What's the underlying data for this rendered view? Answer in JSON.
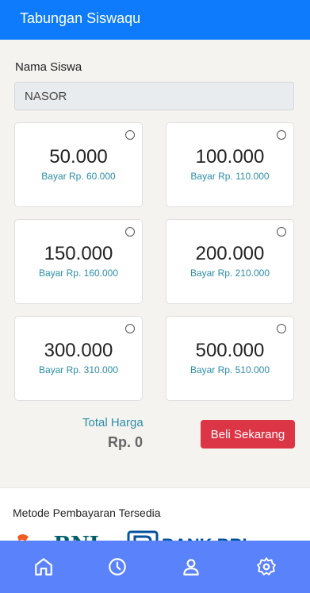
{
  "appbar": {
    "title": "Tabungan Siswaqu"
  },
  "form": {
    "name_label": "Nama Siswa",
    "name_value": "NASOR"
  },
  "options": [
    {
      "amount": "50.000",
      "pay": "Bayar Rp. 60.000",
      "selected": false
    },
    {
      "amount": "100.000",
      "pay": "Bayar Rp. 110.000",
      "selected": false
    },
    {
      "amount": "150.000",
      "pay": "Bayar Rp. 160.000",
      "selected": false
    },
    {
      "amount": "200.000",
      "pay": "Bayar Rp. 210.000",
      "selected": false
    },
    {
      "amount": "300.000",
      "pay": "Bayar Rp. 310.000",
      "selected": false
    },
    {
      "amount": "500.000",
      "pay": "Bayar Rp. 510.000",
      "selected": false
    }
  ],
  "total": {
    "label": "Total Harga",
    "value": "Rp. 0"
  },
  "buy_button": "Beli Sekarang",
  "payment": {
    "title": "Metode Pembayaran Tersedia",
    "logos": [
      "BNI",
      "BANK BRI"
    ]
  },
  "nav": {
    "items": [
      {
        "icon": "home-icon"
      },
      {
        "icon": "history-icon"
      },
      {
        "icon": "user-icon"
      },
      {
        "icon": "settings-icon"
      }
    ]
  },
  "colors": {
    "primary": "#0d7bfb",
    "danger": "#dc3545",
    "nav": "#5a82fb",
    "accent_text": "#2a8da6"
  }
}
